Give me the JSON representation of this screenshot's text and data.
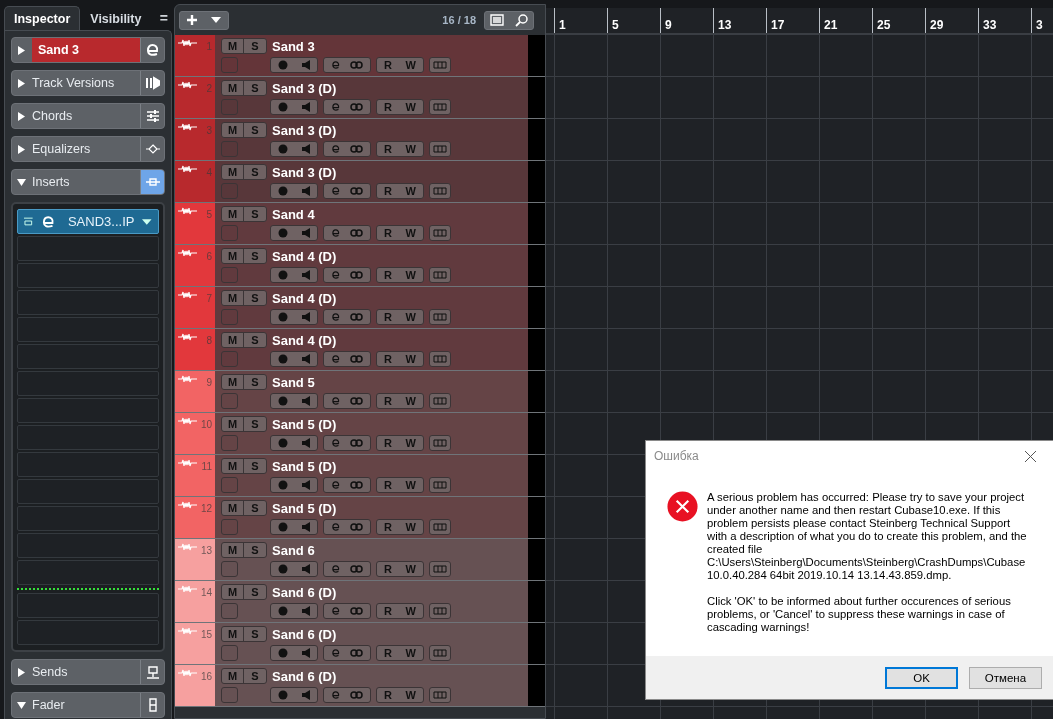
{
  "inspector": {
    "tabs": [
      {
        "label": "Inspector",
        "selected": true
      },
      {
        "label": "Visibility",
        "selected": false
      }
    ],
    "menu_label": "=",
    "sections": [
      {
        "label": "Sand 3",
        "kind": "track",
        "expanded": false,
        "active": false
      },
      {
        "label": "Track Versions",
        "kind": "section",
        "expanded": false,
        "active": false
      },
      {
        "label": "Chords",
        "kind": "section",
        "expanded": false,
        "active": false
      },
      {
        "label": "Equalizers",
        "kind": "section",
        "expanded": false,
        "active": false
      },
      {
        "label": "Inserts",
        "kind": "section",
        "expanded": true,
        "active": true
      },
      {
        "label": "Sends",
        "kind": "section",
        "expanded": false,
        "active": false
      },
      {
        "label": "Fader",
        "kind": "section",
        "expanded": true,
        "active": false
      }
    ],
    "insert_slots": [
      {
        "name": "SAND3...IP",
        "kind": "pre"
      },
      {
        "kind": "pre"
      },
      {
        "kind": "pre"
      },
      {
        "kind": "pre"
      },
      {
        "kind": "pre"
      },
      {
        "kind": "pre"
      },
      {
        "kind": "pre"
      },
      {
        "kind": "pre"
      },
      {
        "kind": "pre"
      },
      {
        "kind": "pre"
      },
      {
        "kind": "pre"
      },
      {
        "kind": "pre"
      },
      {
        "kind": "pre"
      },
      {
        "kind": "pre"
      },
      {
        "kind": "post"
      },
      {
        "kind": "post"
      }
    ]
  },
  "track_list": {
    "count": "16 / 18",
    "tracks": [
      {
        "number": "1",
        "name": "Sand 3",
        "color": "#b8292d",
        "selected": true,
        "mute": "M",
        "solo": "S",
        "read": "R",
        "write": "W"
      },
      {
        "number": "2",
        "name": "Sand 3 (D)",
        "color": "#b8292d",
        "selected": false,
        "mute": "M",
        "solo": "S",
        "read": "R",
        "write": "W"
      },
      {
        "number": "3",
        "name": "Sand 3 (D)",
        "color": "#b8292d",
        "selected": false,
        "mute": "M",
        "solo": "S",
        "read": "R",
        "write": "W"
      },
      {
        "number": "4",
        "name": "Sand 3 (D)",
        "color": "#b8292d",
        "selected": false,
        "mute": "M",
        "solo": "S",
        "read": "R",
        "write": "W"
      },
      {
        "number": "5",
        "name": "Sand 4",
        "color": "#e2383c",
        "selected": false,
        "mute": "M",
        "solo": "S",
        "read": "R",
        "write": "W"
      },
      {
        "number": "6",
        "name": "Sand 4 (D)",
        "color": "#e2383c",
        "selected": false,
        "mute": "M",
        "solo": "S",
        "read": "R",
        "write": "W"
      },
      {
        "number": "7",
        "name": "Sand 4 (D)",
        "color": "#e2383c",
        "selected": false,
        "mute": "M",
        "solo": "S",
        "read": "R",
        "write": "W"
      },
      {
        "number": "8",
        "name": "Sand 4 (D)",
        "color": "#e2383c",
        "selected": false,
        "mute": "M",
        "solo": "S",
        "read": "R",
        "write": "W"
      },
      {
        "number": "9",
        "name": "Sand 5",
        "color": "#f26464",
        "selected": false,
        "mute": "M",
        "solo": "S",
        "read": "R",
        "write": "W"
      },
      {
        "number": "10",
        "name": "Sand 5 (D)",
        "color": "#f26464",
        "selected": false,
        "mute": "M",
        "solo": "S",
        "read": "R",
        "write": "W"
      },
      {
        "number": "11",
        "name": "Sand 5 (D)",
        "color": "#f26464",
        "selected": false,
        "mute": "M",
        "solo": "S",
        "read": "R",
        "write": "W"
      },
      {
        "number": "12",
        "name": "Sand 5 (D)",
        "color": "#f26464",
        "selected": false,
        "mute": "M",
        "solo": "S",
        "read": "R",
        "write": "W"
      },
      {
        "number": "13",
        "name": "Sand 6",
        "color": "#f6a09f",
        "selected": false,
        "mute": "M",
        "solo": "S",
        "read": "R",
        "write": "W"
      },
      {
        "number": "14",
        "name": "Sand 6 (D)",
        "color": "#f6a09f",
        "selected": false,
        "mute": "M",
        "solo": "S",
        "read": "R",
        "write": "W"
      },
      {
        "number": "15",
        "name": "Sand 6 (D)",
        "color": "#f6a09f",
        "selected": false,
        "mute": "M",
        "solo": "S",
        "read": "R",
        "write": "W"
      },
      {
        "number": "16",
        "name": "Sand 6 (D)",
        "color": "#f6a09f",
        "selected": false,
        "mute": "M",
        "solo": "S",
        "read": "R",
        "write": "W"
      }
    ]
  },
  "ruler": {
    "bars": [
      "1",
      "5",
      "9",
      "13",
      "17",
      "21",
      "25",
      "29",
      "33",
      "3"
    ]
  },
  "dialog": {
    "title": "Ошибка",
    "message": "A serious problem has occurred: Please try to save your project under another name and then restart Cubase10.exe. If this problem persists please contact Steinberg Technical Support with a description of what you do to create this problem, and the created file C:\\Users\\Steinberg\\Documents\\Steinberg\\CrashDumps\\Cubase 10.0.40.284 64bit 2019.10.14 13.14.43.859.dmp.",
    "note": "Click 'OK' to be informed about further occurences of serious problems, or 'Cancel' to suppress these warnings in case of cascading warnings!",
    "buttons": [
      {
        "label": "OK",
        "selected": true
      },
      {
        "label": "Отмена",
        "selected": false
      }
    ]
  }
}
